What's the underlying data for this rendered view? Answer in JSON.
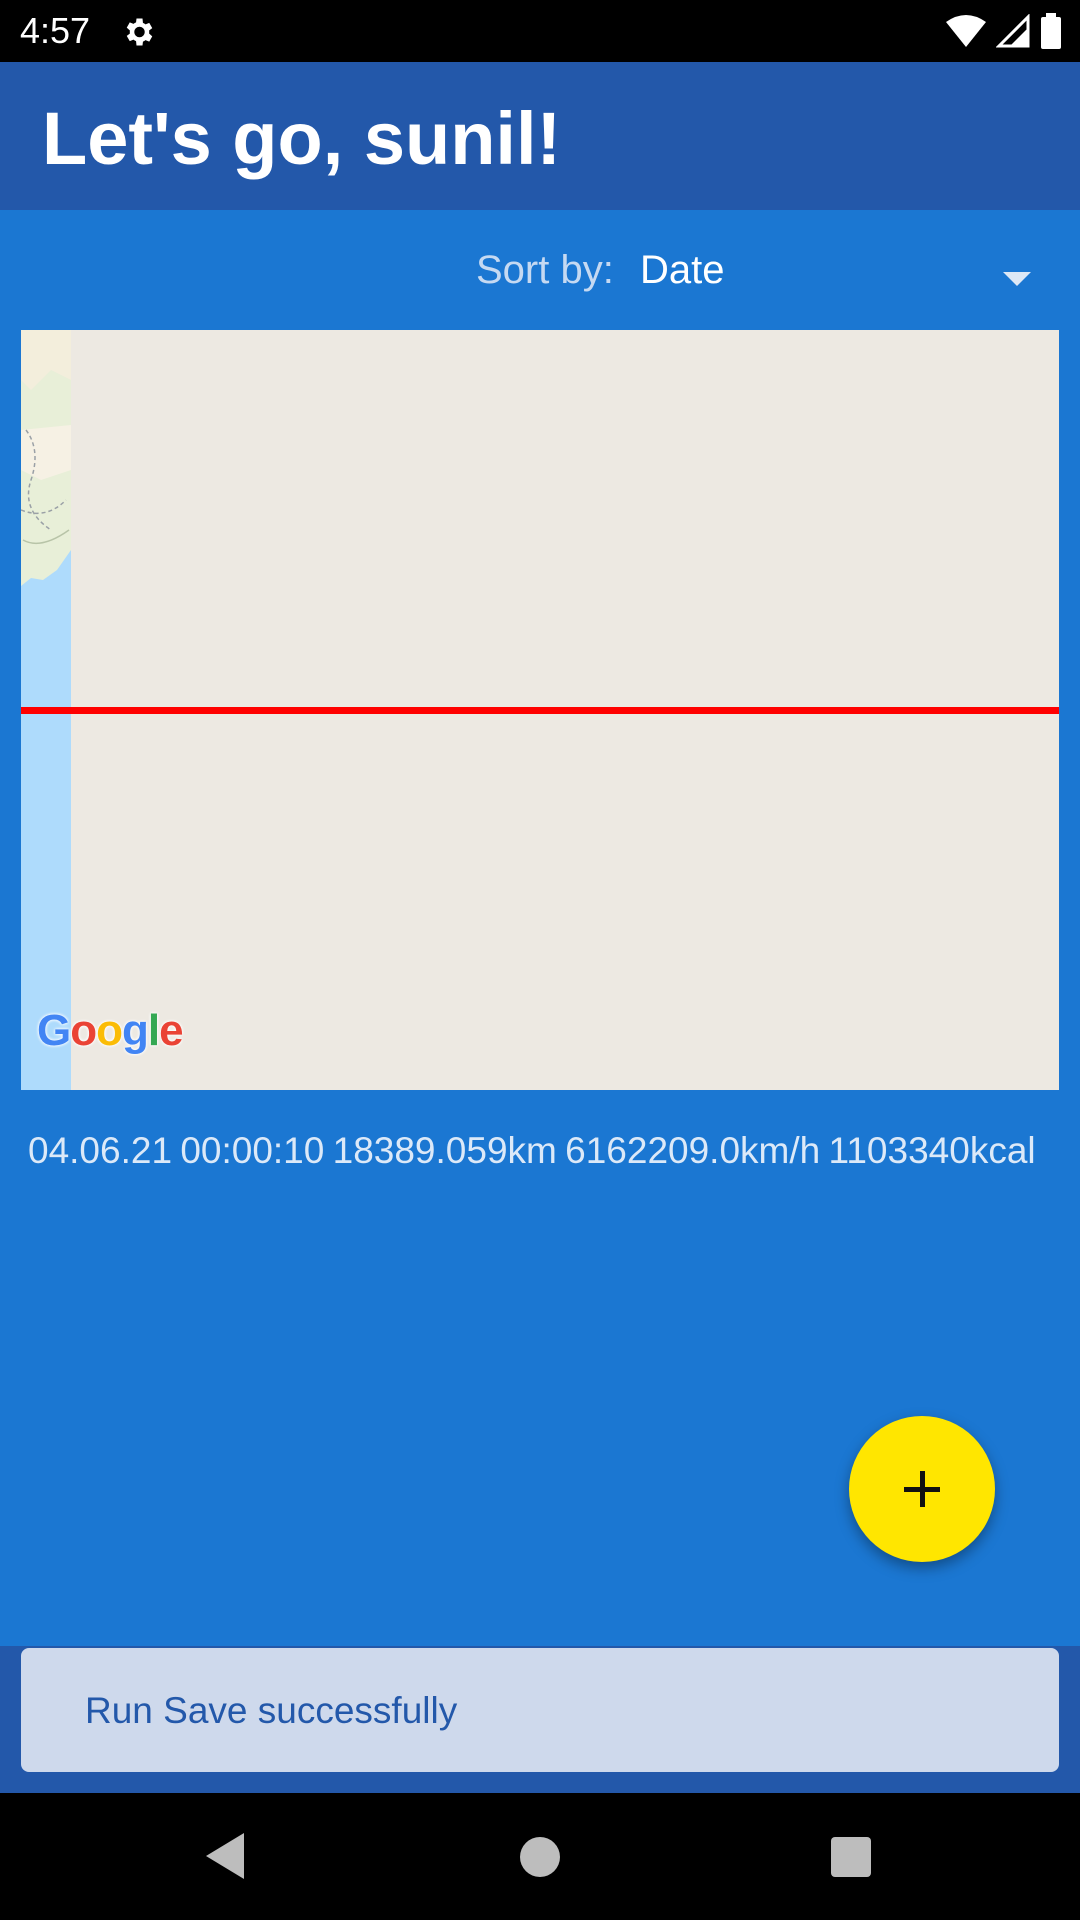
{
  "status_bar": {
    "time": "4:57",
    "icons": [
      "settings-gear-icon",
      "wifi-icon",
      "signal-icon",
      "battery-icon"
    ]
  },
  "app_bar": {
    "title": "Let's go, sunil!"
  },
  "sort": {
    "label": "Sort by:",
    "selected": "Date"
  },
  "map": {
    "attribution": "Google",
    "route_color": "#FF0000"
  },
  "run": {
    "date": "04.06.21",
    "duration": "00:00:10",
    "distance": "18389.059km",
    "speed": "6162209.0km/h",
    "calories": "1103340kcal"
  },
  "fab": {
    "icon": "plus-icon",
    "color": "#FFE600"
  },
  "snackbar": {
    "message": "Run Save successfully"
  },
  "nav_bar": {
    "icons": [
      "back-icon",
      "home-icon",
      "recents-icon"
    ]
  },
  "colors": {
    "app_bar": "#2358AA",
    "content_bg": "#1B77D2",
    "snackbar_bg": "#CED9EC"
  }
}
